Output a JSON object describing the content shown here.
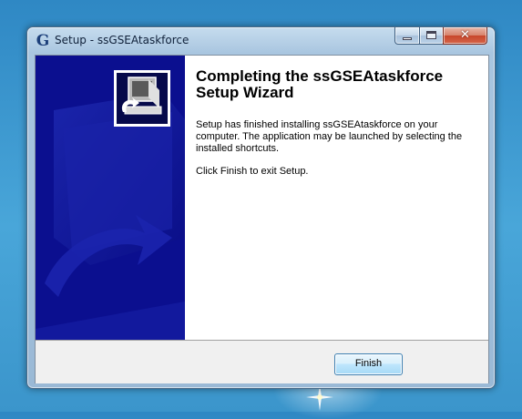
{
  "window": {
    "title": "Setup - ssGSEAtaskforce",
    "icon": "setup-g-icon",
    "caption_buttons": [
      "minimize",
      "maximize",
      "close"
    ]
  },
  "wizard": {
    "heading_line1": "Completing the ssGSEAtaskforce",
    "heading_line2": "Setup Wizard",
    "paragraph1": "Setup has finished installing ssGSEAtaskforce on your computer. The application may be launched by selecting the installed shortcuts.",
    "paragraph2": "Click Finish to exit Setup.",
    "side_image_icon": "computer-install-icon"
  },
  "buttons": {
    "finish_label": "Finish"
  },
  "colors": {
    "side_panel": "#0b0f8f",
    "desktop": "#3b95cb",
    "close_button": "#c8462b"
  }
}
